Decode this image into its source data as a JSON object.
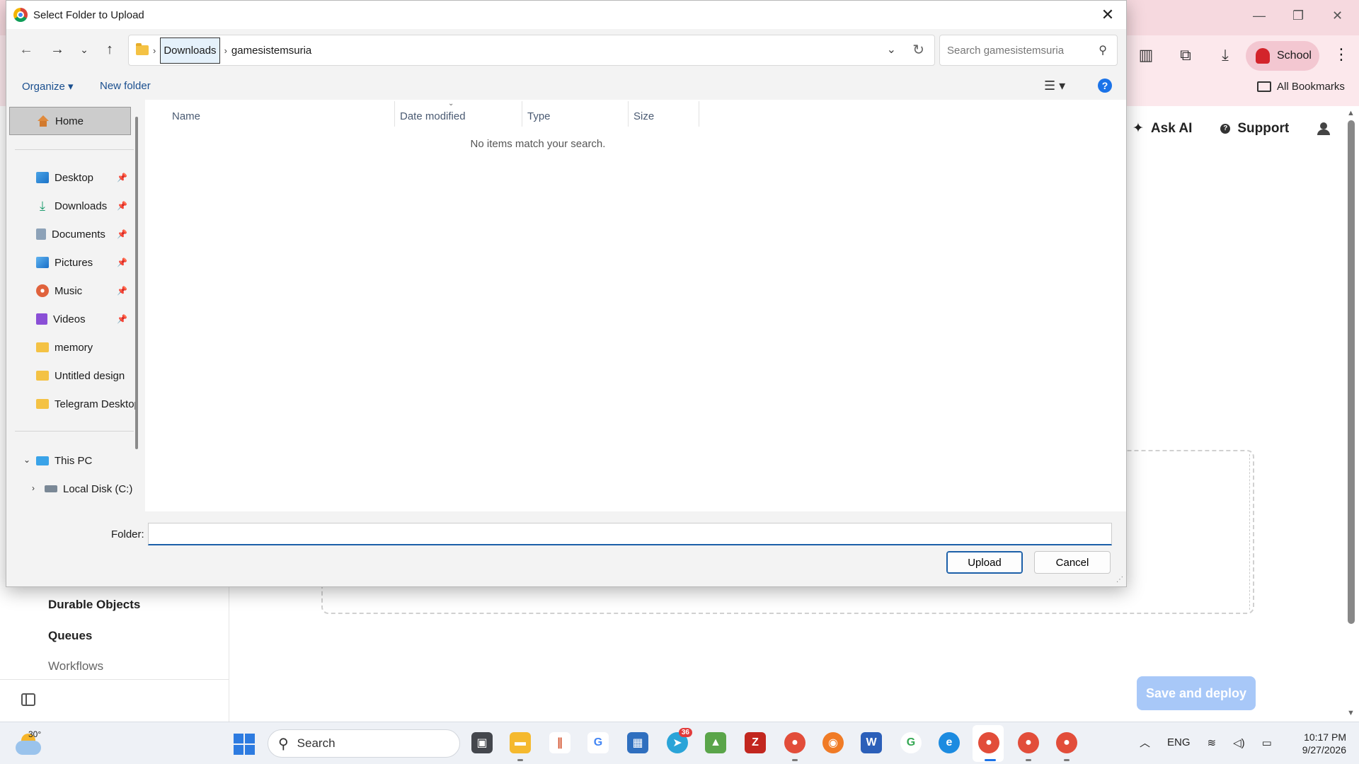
{
  "browser": {
    "profile_label": "School",
    "bookmarks_label": "All Bookmarks",
    "header": {
      "ask_ai": "Ask AI",
      "support": "Support"
    },
    "sidebar": {
      "nav": [
        "Durable Objects",
        "Queues",
        "Workflows"
      ]
    },
    "save_deploy_label": "Save and deploy"
  },
  "dialog": {
    "title": "Select Folder to Upload",
    "breadcrumbs": [
      "Downloads",
      "gamesistemsuria"
    ],
    "search_placeholder": "Search gamesistemsuria",
    "toolbar": {
      "organize": "Organize",
      "new_folder": "New folder"
    },
    "navigation": {
      "home": "Home",
      "quick_access": [
        {
          "label": "Desktop",
          "icon": "desktop-icon"
        },
        {
          "label": "Downloads",
          "icon": "download-icon"
        },
        {
          "label": "Documents",
          "icon": "documents-icon"
        },
        {
          "label": "Pictures",
          "icon": "pictures-icon"
        },
        {
          "label": "Music",
          "icon": "music-icon"
        },
        {
          "label": "Videos",
          "icon": "videos-icon"
        },
        {
          "label": "memory",
          "icon": "folder-icon"
        },
        {
          "label": "Untitled design",
          "icon": "folder-icon"
        },
        {
          "label": "Telegram Desktop",
          "icon": "folder-icon"
        }
      ],
      "this_pc": "This PC",
      "local_disk": "Local Disk (C:)"
    },
    "columns": [
      "Name",
      "Date modified",
      "Type",
      "Size"
    ],
    "empty_message": "No items match your search.",
    "folder_label": "Folder:",
    "folder_value": "",
    "upload_label": "Upload",
    "cancel_label": "Cancel"
  },
  "taskbar": {
    "weather_temp": "30°",
    "search_label": "Search",
    "telegram_badge": "36",
    "tray": {
      "language": "ENG"
    },
    "clock": {
      "time": "10:17 PM",
      "date": "9/27/2026"
    }
  },
  "colors": {
    "accent": "#1b5fa8",
    "browser_pink": "#fce8ec",
    "deploy_button": "#a8c8f8"
  }
}
